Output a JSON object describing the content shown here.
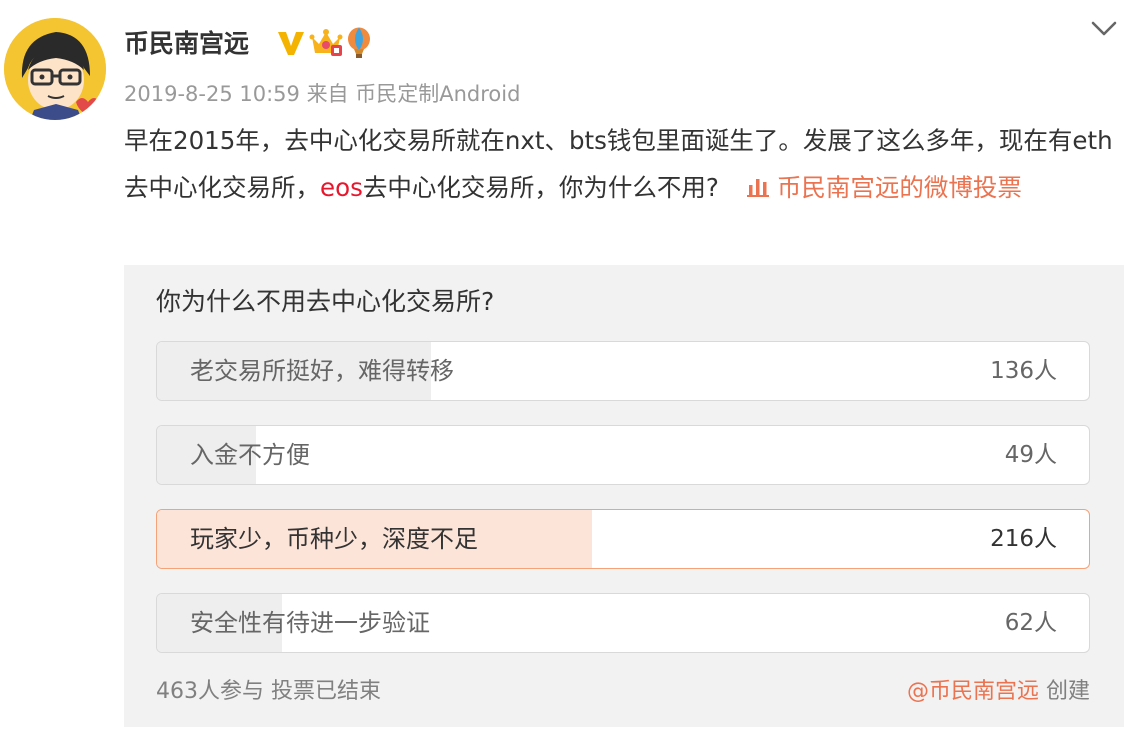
{
  "post": {
    "author": {
      "name": "币民南宫远",
      "avatar_icon": "cartoon-avatar-with-glasses",
      "badges": [
        "verified-v-icon",
        "vip-crown-icon",
        "balloon-icon"
      ]
    },
    "timestamp": "2019-8-25 10:59",
    "from_label": "来自",
    "source": "币民定制Android",
    "text": {
      "part1": "早在2015年，去中心化交易所就在nxt、bts钱包里面诞生了。发展了这么多年，现在有eth去中心化交易所，",
      "highlight": "eos",
      "part2": "去中心化交易所，你为什么不用?",
      "vote_link": "币民南宫远的微博投票",
      "vote_link_icon": "poll-chart-icon"
    }
  },
  "poll": {
    "question": "你为什么不用去中心化交易所?",
    "options": [
      {
        "label": "老交易所挺好，难得转移",
        "count": "136人",
        "votes": 136,
        "selected": false
      },
      {
        "label": "入金不方便",
        "count": "49人",
        "votes": 49,
        "selected": false
      },
      {
        "label": "玩家少，币种少，深度不足",
        "count": "216人",
        "votes": 216,
        "selected": true
      },
      {
        "label": "安全性有待进一步验证",
        "count": "62人",
        "votes": 62,
        "selected": false
      }
    ],
    "total": 463,
    "footer_participants": "463人参与",
    "footer_status": "投票已结束",
    "creator": "@币民南宫远",
    "creator_suffix": "创建"
  },
  "colors": {
    "accent": "#eb7350",
    "highlight": "#e6162d",
    "selected_fill": "#fde4d9",
    "selected_border": "#f5a278"
  }
}
